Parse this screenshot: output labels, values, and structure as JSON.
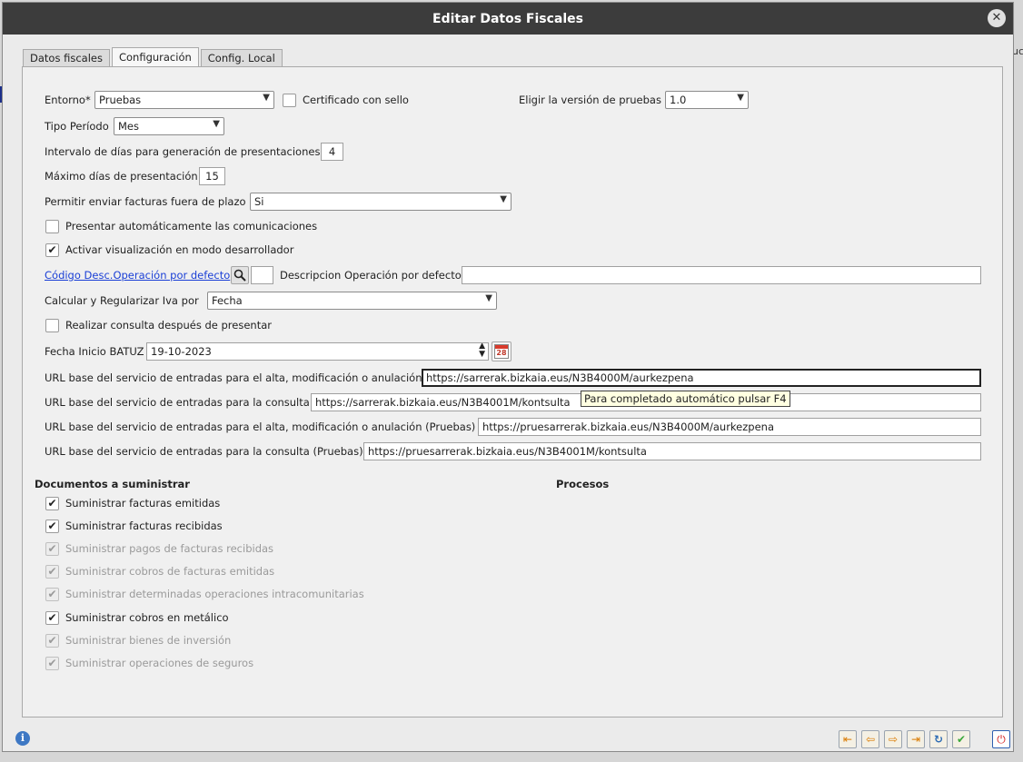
{
  "background": {
    "right_fragment": "uc"
  },
  "window": {
    "title": "Editar Datos Fiscales",
    "close_glyph": "✕"
  },
  "tabs": [
    {
      "label": "Datos fiscales"
    },
    {
      "label": "Configuración"
    },
    {
      "label": "Config. Local"
    }
  ],
  "form": {
    "entorno_label": "Entorno*",
    "entorno_value": "Pruebas",
    "certificado_label": "Certificado con sello",
    "certificado_checked": false,
    "version_label": "Eligir la versión de pruebas",
    "version_value": "1.0",
    "tipo_periodo_label": "Tipo Período",
    "tipo_periodo_value": "Mes",
    "intervalo_label": "Intervalo de días para generación de presentaciones",
    "intervalo_value": "4",
    "maximo_label": "Máximo días de presentación",
    "maximo_value": "15",
    "permitir_label": "Permitir enviar facturas fuera de plazo",
    "permitir_value": "Si",
    "presentar_auto_label": "Presentar automáticamente las comunicaciones",
    "presentar_auto_checked": false,
    "modo_desarrollador_label": "Activar visualización en modo desarrollador",
    "modo_desarrollador_checked": true,
    "codigo_desc_link": "Código Desc.Operación por defecto",
    "codigo_desc_value": "",
    "descripcion_label": "Descripcion Operación por defecto",
    "descripcion_value": "",
    "calcular_label": "Calcular y Regularizar Iva por",
    "calcular_value": "Fecha",
    "consulta_label": "Realizar consulta después de presentar",
    "consulta_checked": false,
    "fecha_inicio_label": "Fecha Inicio BATUZ",
    "fecha_inicio_value": "19-10-2023",
    "calendar_day": "28",
    "url_alta_label": "URL base del servicio de entradas para el alta, modificación o anulación",
    "url_alta_value": "https://sarrerak.bizkaia.eus/N3B4000M/aurkezpena",
    "url_consulta_label": "URL base del servicio de entradas para la consulta",
    "url_consulta_value": "https://sarrerak.bizkaia.eus/N3B4001M/kontsulta",
    "url_alta_pruebas_label": "URL base del servicio de entradas para el alta, modificación o anulación (Pruebas)",
    "url_alta_pruebas_value": "https://pruesarrerak.bizkaia.eus/N3B4000M/aurkezpena",
    "url_consulta_pruebas_label": "URL base del servicio de entradas para la consulta (Pruebas)",
    "url_consulta_pruebas_value": "https://pruesarrerak.bizkaia.eus/N3B4001M/kontsulta",
    "tooltip": "Para completado automático pulsar F4"
  },
  "documentos": {
    "title": "Documentos a suministrar",
    "items": [
      {
        "label": "Suministrar facturas emitidas",
        "checked": true,
        "enabled": true
      },
      {
        "label": "Suministrar facturas recibidas",
        "checked": true,
        "enabled": true
      },
      {
        "label": "Suministrar pagos de facturas recibidas",
        "checked": true,
        "enabled": false
      },
      {
        "label": "Suministrar cobros de facturas emitidas",
        "checked": true,
        "enabled": false
      },
      {
        "label": "Suministrar determinadas operaciones intracomunitarias",
        "checked": true,
        "enabled": false
      },
      {
        "label": "Suministrar cobros en metálico",
        "checked": true,
        "enabled": true
      },
      {
        "label": "Suministrar bienes de inversión",
        "checked": true,
        "enabled": false
      },
      {
        "label": "Suministrar operaciones de seguros",
        "checked": true,
        "enabled": false
      }
    ]
  },
  "procesos": {
    "title": "Procesos"
  },
  "toolbar": {
    "info_glyph": "i",
    "first_glyph": "⇤",
    "prev_glyph": "⇦",
    "next_glyph": "⇨",
    "last_glyph": "⇥",
    "refresh_glyph": "↻",
    "accept_glyph": "✔",
    "exit_glyph": "⏻"
  },
  "colors": {
    "link": "#1a3fd6",
    "titlebar": "#3c3c3c",
    "tooltip_bg": "#ffffe1"
  }
}
